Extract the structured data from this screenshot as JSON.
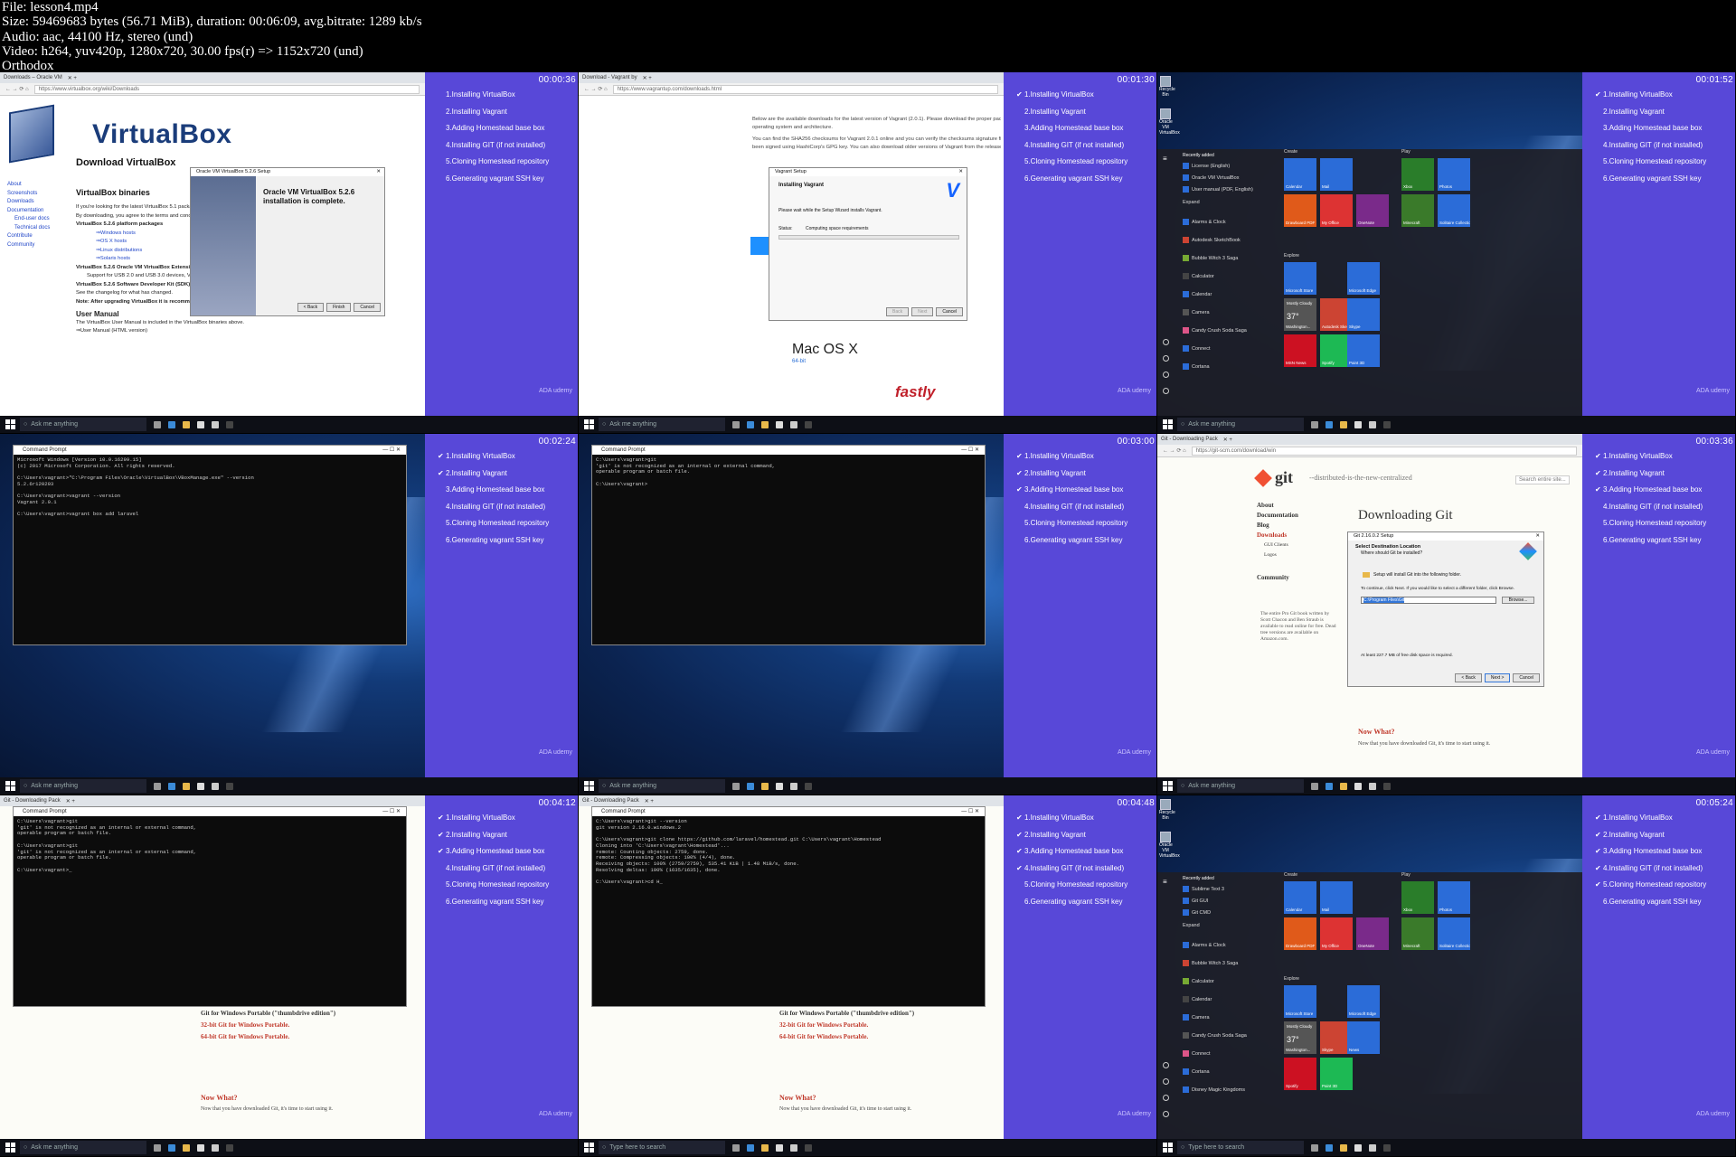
{
  "header": {
    "file": "File: lesson4.mp4",
    "size": "Size: 59469683 bytes (56.71 MiB), duration: 00:06:09, avg.bitrate: 1289 kb/s",
    "audio": "Audio: aac, 44100 Hz, stereo (und)",
    "video": "Video: h264, yuv420p, 1280x720, 30.00 fps(r) => 1152x720 (und)",
    "author": "Orthodox"
  },
  "checklist": [
    "1.Installing VirtualBox",
    "2.Installing Vagrant",
    "3.Adding Homestead base box",
    "4.Installing GIT (if not installed)",
    "5.Cloning Homestead repository",
    "6.Generating vagrant SSH key"
  ],
  "panel_logo": "ADA udemy",
  "search": {
    "cortana": "Ask me anything",
    "win10": "Type here to search"
  },
  "thumbs": [
    {
      "time": "00:00:36",
      "done": 0,
      "tab": "Downloads – Oracle VM",
      "url": "https://www.virtualbox.org/wiki/Downloads",
      "brand": "VirtualBox",
      "heading": "Download VirtualBox",
      "sub": "VirtualBox binaries",
      "nav": [
        "About",
        "Screenshots",
        "Downloads",
        "Documentation",
        "End-user docs",
        "Technical docs",
        "Contribute",
        "Community"
      ],
      "lines": [
        "If you're looking for the latest VirtualBox 5.1 packages, see VirtualBox 5.1 builds.",
        "By downloading, you agree to the terms and conditions of the respective license.",
        "VirtualBox 5.2.6 platform packages",
        "⇒Windows hosts",
        "⇒OS X hosts",
        "⇒Linux distributions",
        "⇒Solaris hosts",
        "VirtualBox 5.2.6 Oracle VM VirtualBox Extension Pack",
        "Support for USB 2.0 and USB 3.0 devices, VirtualBox RDP, disk encryption, NVMe and PXE boot for Intel cards.",
        "VirtualBox 5.2.6 Software Developer Kit (SDK) ⇒All platforms",
        "See the changelog for what has changed.",
        "Note: After upgrading VirtualBox it is recommended to upgrade the guest additions as well.",
        "User Manual",
        "The VirtualBox User Manual is included in the VirtualBox binaries above.",
        "⇒User Manual (HTML version)"
      ],
      "dialog_title": "Oracle VM VirtualBox 5.2.6 Setup",
      "dialog_text": "Oracle VM VirtualBox 5.2.6 installation is complete.",
      "dialog_btns": [
        "< Back",
        "Finish",
        "Cancel"
      ]
    },
    {
      "time": "00:01:30",
      "done": 1,
      "tab": "Download - Vagrant by",
      "url": "https://www.vagrantup.com/downloads.html",
      "lines": [
        "Below are the available downloads for the latest version of Vagrant (2.0.1). Please download the proper package for your",
        "operating system and architecture.",
        "You can find the SHA256 checksums for Vagrant 2.0.1 online and you can verify the checksums signature file which has",
        "been signed using HashiCorp's GPG key. You can also download older versions of Vagrant from the releases service."
      ],
      "dialog_title": "Vagrant Setup",
      "dialog_head": "Installing Vagrant",
      "dialog_text": "Please wait while the Setup Wizard installs Vagrant.",
      "status_label": "Status:",
      "status": "Computing space requirements",
      "dialog_btns": [
        "Back",
        "Next",
        "Cancel"
      ],
      "os": "Mac OS X",
      "os_sub": "64-bit",
      "sponsor": "fastly"
    },
    {
      "time": "00:01:52",
      "done": 1,
      "desktop_icons": [
        "Recycle Bin",
        "Oracle VM VirtualBox"
      ],
      "recent_label": "Recently added",
      "recent": [
        "License (English)",
        "Oracle VM VirtualBox",
        "User manual (PDF, English)"
      ],
      "expand": "Expand",
      "apps": [
        "Alarms & Clock",
        "Autodesk SketchBook",
        "Bubble Witch 3 Saga",
        "Calculator",
        "Calendar",
        "Camera",
        "Candy Crush Soda Saga",
        "Connect",
        "Cortana"
      ],
      "groups": [
        "Create",
        "Play",
        "Explore"
      ],
      "tiles": [
        "Calendar",
        "Mail",
        "Xbox",
        "Photos",
        "Drawboard PDF",
        "My Office",
        "OneNote",
        "Minecraft",
        "Solitaire Collection",
        "Microsoft Store",
        "Microsoft Edge",
        "Washington...",
        "Autodesk Ske...",
        "Skype",
        "MSN News",
        "Spotify",
        "Paint 3D"
      ],
      "weather": "37°",
      "weather_note": "Mostly Cloudy"
    },
    {
      "time": "00:02:24",
      "done": 2,
      "cmd_title": "Command Prompt",
      "cmd": "Microsoft Windows [Version 10.0.16299.15]\n(c) 2017 Microsoft Corporation. All rights reserved.\n\nC:\\Users\\vagrant>\"C:\\Program Files\\Oracle\\VirtualBox\\VBoxManage.exe\" --version\n5.2.6r120293\n\nC:\\Users\\vagrant>vagrant --version\nVagrant 2.0.1\n\nC:\\Users\\vagrant>vagrant box add laravel"
    },
    {
      "time": "00:03:00",
      "done": 3,
      "cmd_title": "Command Prompt",
      "cmd": "C:\\Users\\vagrant>git\n'git' is not recognized as an internal or external command,\noperable program or batch file.\n\nC:\\Users\\vagrant>"
    },
    {
      "time": "00:03:36",
      "done": 3,
      "tab": "Git - Downloading Pack",
      "url": "https://git-scm.com/download/win",
      "brand": "git",
      "tagline": "--distributed-is-the-new-centralized",
      "search": "Search entire site...",
      "nav": [
        "About",
        "Documentation",
        "Blog",
        "Downloads",
        "GUI Clients",
        "Logos",
        "Community"
      ],
      "heading": "Downloading Git",
      "promo": "The entire Pro Git book written by Scott Chacon and Ben Straub is available to read online for free. Dead tree versions are available on Amazon.com.",
      "dialog_title": "Git 2.16.0.2 Setup",
      "dialog_head": "Select Destination Location",
      "dialog_sub": "Where should Git be installed?",
      "dialog_text": "Setup will install Git into the following folder.",
      "dialog_text2": "To continue, click Next. If you would like to select a different folder, click Browse.",
      "path": "C:\\Program Files\\Git",
      "browse": "Browse...",
      "space": "At least 227.7 MB of free disk space is required.",
      "dialog_btns": [
        "< Back",
        "Next >",
        "Cancel"
      ],
      "now": "Now What?",
      "now_text": "Now that you have downloaded Git, it's time to start using it."
    },
    {
      "time": "00:04:12",
      "done": 3,
      "cmd_title": "Command Prompt",
      "tab": "Git - Downloading Pack",
      "cmd": "C:\\Users\\vagrant>git\n'git' is not recognized as an internal or external command,\noperable program or batch file.\n\nC:\\Users\\vagrant>git\n'git' is not recognized as an internal or external command,\noperable program or batch file.\n\nC:\\Users\\vagrant>_",
      "bg_lines": [
        "Git for Windows Portable (\"thumbdrive edition\")",
        "32-bit Git for Windows Portable.",
        "64-bit Git for Windows Portable."
      ],
      "now": "Now What?",
      "now_text": "Now that you have downloaded Git, it's time to start using it."
    },
    {
      "time": "00:04:48",
      "done": 4,
      "cmd_title": "Command Prompt",
      "tab": "Git - Downloading Pack",
      "cmd": "C:\\Users\\vagrant>git --version\ngit version 2.16.0.windows.2\n\nC:\\Users\\vagrant>git clone https://github.com/laravel/homestead.git C:\\Users\\vagrant\\Homestead\nCloning into 'C:\\Users\\vagrant\\Homestead'...\nremote: Counting objects: 2759, done.\nremote: Compressing objects: 100% (4/4), done.\nReceiving objects: 100% (2759/2759), 535.41 KiB | 1.48 MiB/s, done.\nResolving deltas: 100% (1635/1635), done.\n\nC:\\Users\\vagrant>cd H_",
      "bg_lines": [
        "Git for Windows Portable (\"thumbdrive edition\")",
        "32-bit Git for Windows Portable.",
        "64-bit Git for Windows Portable."
      ],
      "now": "Now What?",
      "now_text": "Now that you have downloaded Git, it's time to start using it."
    },
    {
      "time": "00:05:24",
      "done": 5,
      "desktop_icons": [
        "Recycle Bin",
        "Oracle VM VirtualBox"
      ],
      "recent_label": "Recently added",
      "recent": [
        "Sublime Text 3",
        "Git GUI",
        "Git CMD"
      ],
      "expand": "Expand",
      "apps": [
        "Alarms & Clock",
        "Bubble Witch 3 Saga",
        "Calculator",
        "Calendar",
        "Camera",
        "Candy Crush Soda Saga",
        "Connect",
        "Cortana",
        "Disney Magic Kingdoms"
      ],
      "groups": [
        "Create",
        "Play",
        "Explore"
      ],
      "tiles": [
        "Calendar",
        "Mail",
        "Xbox",
        "Photos",
        "Drawboard PDF",
        "My Office",
        "OneNote",
        "Minecraft",
        "Solitaire Collection",
        "Microsoft Store",
        "Microsoft Edge",
        "Washington...",
        "Skype",
        "News",
        "Spotify",
        "Paint 3D"
      ],
      "weather": "37°",
      "weather_note": "Mostly Cloudy"
    }
  ],
  "colors": {
    "panel": "#5848d8",
    "desktop": "#0b2350",
    "taskbar": "#0d0f16",
    "cmd": "#0c0c0c"
  }
}
